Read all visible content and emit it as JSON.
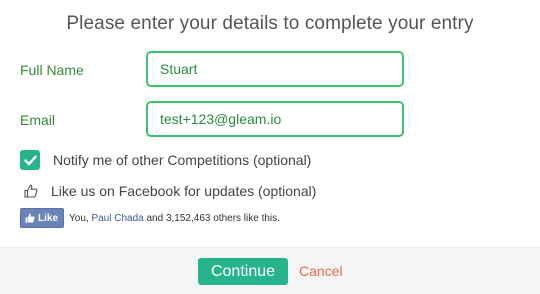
{
  "title": "Please enter your details to complete your entry",
  "fields": {
    "name": {
      "label": "Full Name",
      "value": "Stuart"
    },
    "email": {
      "label": "Email",
      "value": "test+123@gleam.io"
    }
  },
  "notify": {
    "label": "Notify me of other Competitions (optional)",
    "checked": true
  },
  "facebook": {
    "label": "Like us on Facebook for updates (optional)",
    "like_button": "Like",
    "social_prefix": "You,",
    "social_friend": "Paul Chada",
    "social_suffix": "and 3,152,463 others like this."
  },
  "footer": {
    "continue_label": "Continue",
    "cancel_label": "Cancel"
  },
  "colors": {
    "accent": "#27b48d",
    "input_border": "#3cc26a",
    "label_green": "#3a8a3a",
    "cancel": "#e66a4a",
    "facebook": "#6c83b9"
  }
}
